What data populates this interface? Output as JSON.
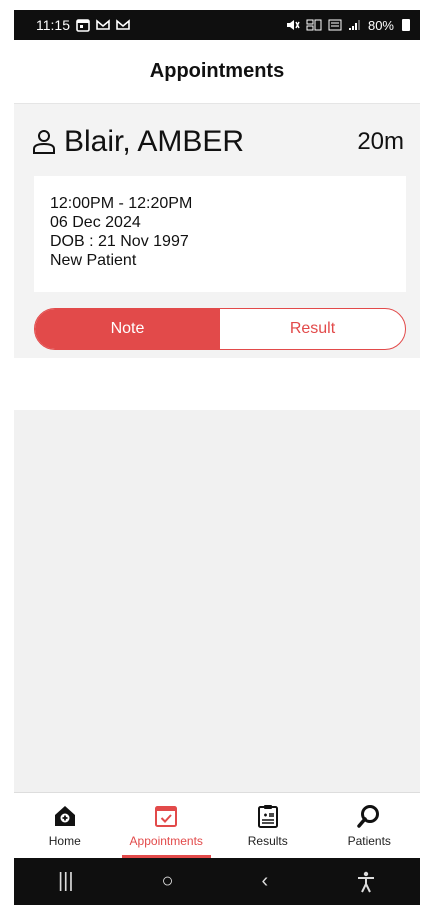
{
  "status_bar": {
    "time": "11:15",
    "left_icons": [
      "calendar-icon",
      "mail-icon",
      "mail-icon"
    ],
    "battery": "80%"
  },
  "header": {
    "title": "Appointments"
  },
  "appointment": {
    "patient_name": "Blair, AMBER",
    "duration": "20m",
    "time_range": "12:00PM - 12:20PM",
    "date": "06 Dec 2024",
    "dob": "DOB : 21 Nov 1997",
    "patient_type": "New Patient"
  },
  "toggle": {
    "active": "Note",
    "options": [
      "Note",
      "Result"
    ]
  },
  "bottom_nav": {
    "items": [
      {
        "label": "Home",
        "icon": "home-icon"
      },
      {
        "label": "Appointments",
        "icon": "calendar-check-icon",
        "active": true
      },
      {
        "label": "Results",
        "icon": "clipboard-icon"
      },
      {
        "label": "Patients",
        "icon": "search-icon"
      }
    ]
  },
  "system_nav": {
    "recent": "|||",
    "home": "○",
    "back": "‹",
    "accessibility": "accessibility-icon"
  },
  "colors": {
    "accent": "#e24a4a",
    "status_bar": "#0f0f0f"
  }
}
